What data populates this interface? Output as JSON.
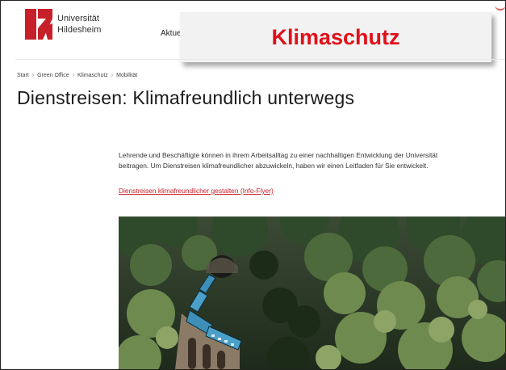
{
  "header": {
    "logo_line1": "Universität",
    "logo_line2": "Hildesheim",
    "nav_item": "Aktue",
    "brand_color": "#c8202a"
  },
  "banner": {
    "text": "Klimaschutz",
    "color": "#e0101a"
  },
  "breadcrumb": [
    "Start",
    "Green Office",
    "Klimaschutz",
    "Mobilität"
  ],
  "page": {
    "title": "Dienstreisen: Klimafreundlich unterwegs",
    "intro_line1": "Lehrende und Beschäftigte können in ihrem Arbeitsalltag zu einer nachhaltigen Entwicklung der Universität",
    "intro_line2": "beitragen. Um Dienstreisen klimafreundlicher abzuwickeln, haben wir einen Leitfaden für Sie entwickelt.",
    "flyer_link": "Dienstreisen klimafreundlicher gestalten (Info-Flyer)",
    "link_color": "#c8202a"
  },
  "hero_image": {
    "icon": "photo-train-forest"
  }
}
